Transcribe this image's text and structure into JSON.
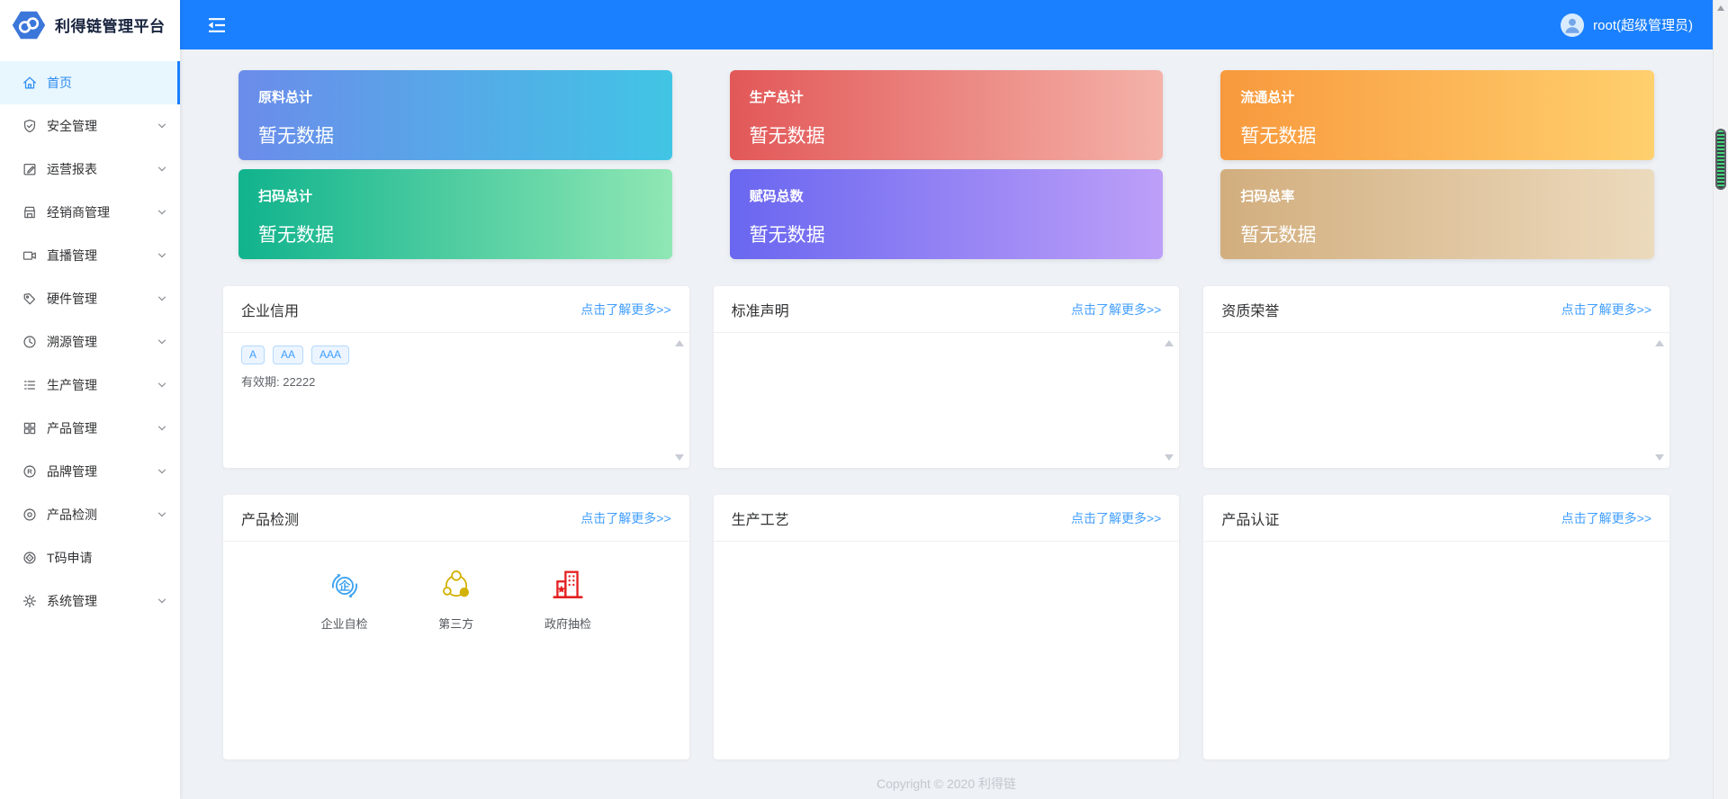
{
  "app": {
    "title": "利得链管理平台"
  },
  "topbar": {
    "collapse_icon": "fold-icon",
    "user": {
      "name": "root(超级管理员)",
      "avatar_icon": "user-icon"
    }
  },
  "sidebar": {
    "items": [
      {
        "name": "home",
        "label": "首页",
        "icon": "home-icon",
        "active": true,
        "has_children": false
      },
      {
        "name": "security",
        "label": "安全管理",
        "icon": "shield-icon",
        "active": false,
        "has_children": true
      },
      {
        "name": "reports",
        "label": "运营报表",
        "icon": "report-icon",
        "active": false,
        "has_children": true
      },
      {
        "name": "dealers",
        "label": "经销商管理",
        "icon": "shop-icon",
        "active": false,
        "has_children": true
      },
      {
        "name": "live",
        "label": "直播管理",
        "icon": "video-icon",
        "active": false,
        "has_children": true
      },
      {
        "name": "hardware",
        "label": "硬件管理",
        "icon": "tag-icon",
        "active": false,
        "has_children": true
      },
      {
        "name": "trace",
        "label": "溯源管理",
        "icon": "clock-icon",
        "active": false,
        "has_children": true
      },
      {
        "name": "production",
        "label": "生产管理",
        "icon": "list-icon",
        "active": false,
        "has_children": true
      },
      {
        "name": "products",
        "label": "产品管理",
        "icon": "grid-icon",
        "active": false,
        "has_children": true
      },
      {
        "name": "brand",
        "label": "品牌管理",
        "icon": "registered-icon",
        "active": false,
        "has_children": true
      },
      {
        "name": "inspection",
        "label": "产品检测",
        "icon": "eye-icon",
        "active": false,
        "has_children": true
      },
      {
        "name": "tcode",
        "label": "T码申请",
        "icon": "tcode-icon",
        "active": false,
        "has_children": false
      },
      {
        "name": "system",
        "label": "系统管理",
        "icon": "gear-icon",
        "active": false,
        "has_children": true
      }
    ]
  },
  "stats": {
    "cards": [
      {
        "name": "material-total",
        "title": "原料总计",
        "value": "暂无数据",
        "gradient_from": "#6b8cea",
        "gradient_to": "#41c5e5"
      },
      {
        "name": "production-total",
        "title": "生产总计",
        "value": "暂无数据",
        "gradient_from": "#e25858",
        "gradient_to": "#f4b2a8"
      },
      {
        "name": "circulation-total",
        "title": "流通总计",
        "value": "暂无数据",
        "gradient_from": "#f8993d",
        "gradient_to": "#ffd06e"
      },
      {
        "name": "scan-total",
        "title": "扫码总计",
        "value": "暂无数据",
        "gradient_from": "#10b38d",
        "gradient_to": "#8fe7b4"
      },
      {
        "name": "code-total",
        "title": "赋码总数",
        "value": "暂无数据",
        "gradient_from": "#6966f0",
        "gradient_to": "#bd9ff8"
      },
      {
        "name": "scan-rate",
        "title": "扫码总率",
        "value": "暂无数据",
        "gradient_from": "#d2ae7e",
        "gradient_to": "#ecdabd"
      }
    ]
  },
  "more_link_label": "点击了解更多>>",
  "panels": [
    {
      "name": "credit",
      "title": "企业信用",
      "body": "credit",
      "tags": [
        "A",
        "AA",
        "AAA"
      ],
      "validity": "有效期: 22222"
    },
    {
      "name": "standard",
      "title": "标准声明",
      "body": "empty"
    },
    {
      "name": "honor",
      "title": "资质荣誉",
      "body": "empty"
    }
  ],
  "bottom_panels": [
    {
      "name": "detect",
      "title": "产品检测",
      "body": "detect",
      "items": [
        {
          "name": "enterprise-self-check",
          "label": "企业自检",
          "icon": "enterprise-self-check-icon",
          "color": "#3aa1f0"
        },
        {
          "name": "third-party",
          "label": "第三方",
          "icon": "third-party-icon",
          "color": "#d3b100"
        },
        {
          "name": "government-check",
          "label": "政府抽检",
          "icon": "government-check-icon",
          "color": "#e42121"
        }
      ]
    },
    {
      "name": "craft",
      "title": "生产工艺",
      "body": "empty"
    },
    {
      "name": "cert",
      "title": "产品认证",
      "body": "empty"
    }
  ],
  "footer": {
    "copyright": "Copyright © 2020 利得链"
  },
  "colors": {
    "topbar": "#1a80ff",
    "link": "#409eff",
    "sidebar_active_bg": "#e8f6fe",
    "sidebar_active_text": "#2d8cf0",
    "tag_text": "#409eff",
    "tag_bg": "#ecf5ff",
    "tag_border": "#b3d8ff",
    "background": "#eef1f5"
  }
}
